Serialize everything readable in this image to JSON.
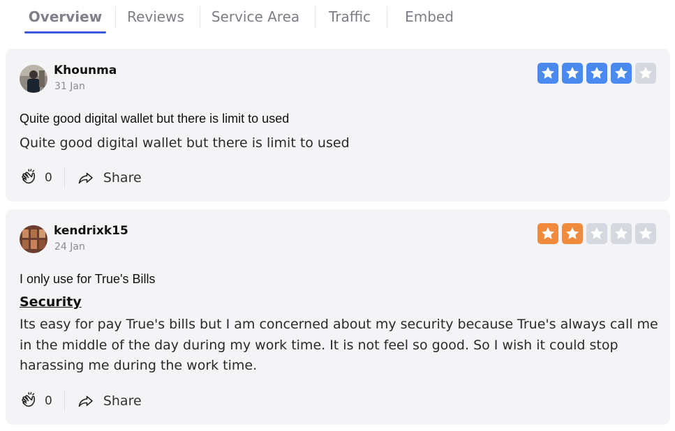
{
  "tabs": [
    {
      "label": "Overview",
      "active": true
    },
    {
      "label": "Reviews",
      "active": false
    },
    {
      "label": "Service Area",
      "active": false
    },
    {
      "label": "Traffic",
      "active": false
    },
    {
      "label": "Embed",
      "active": false
    }
  ],
  "colors": {
    "tab_underline": "#3a5bd9",
    "star_blue": "#4a8af0",
    "star_orange": "#f08a3c",
    "star_empty": "#d5d8df",
    "card_bg": "#f4f4f7"
  },
  "reviews": [
    {
      "author": "Khounma",
      "date": "31 Jan",
      "rating": 4,
      "star_color": "blue",
      "title": "Quite good digital wallet but there is limit to used",
      "subheading": "",
      "body": "Quite good digital wallet but there is limit to used",
      "claps": "0",
      "share_label": "Share"
    },
    {
      "author": "kendrixk15",
      "date": "24 Jan",
      "rating": 2,
      "star_color": "orange",
      "title": "I only use for True's Bills",
      "subheading": "Security",
      "body": "Its easy for pay True's bills but I am concerned about my security because True's always call me in the middle of the day during my work time. It is not feel so good. So I wish it could stop harassing me during the work time.",
      "claps": "0",
      "share_label": "Share"
    }
  ]
}
